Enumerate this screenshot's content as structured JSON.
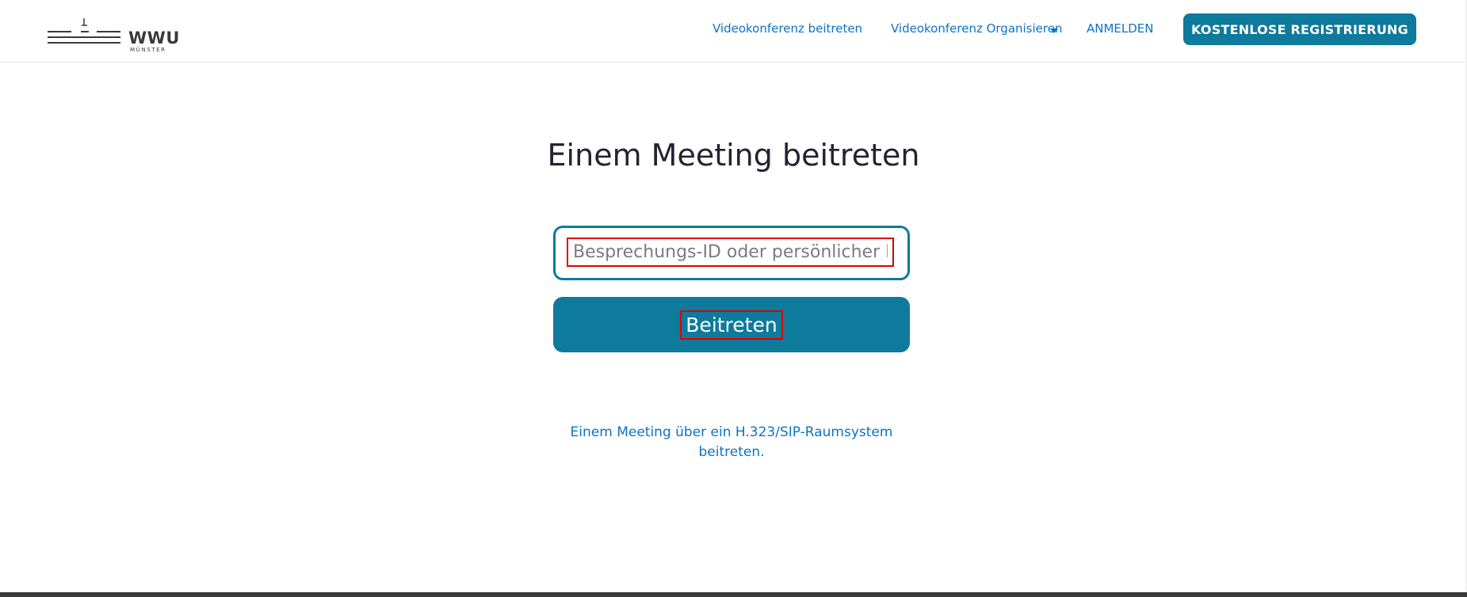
{
  "header": {
    "logo": {
      "name": "WWU",
      "sub": "MÜNSTER"
    },
    "nav": {
      "join_meeting": "Videokonferenz beitreten",
      "host_meeting": "Videokonferenz Organisieren",
      "sign_in": "ANMELDEN",
      "sign_up": "KOSTENLOSE REGISTRIERUNG"
    }
  },
  "main": {
    "title": "Einem Meeting beitreten",
    "meeting_input": {
      "placeholder": "Besprechungs-ID oder persönlicher Link-Name",
      "value": ""
    },
    "join_button": "Beitreten",
    "sip_link": "Einem Meeting über ein H.323/SIP-Raumsystem beitreten."
  },
  "colors": {
    "accent": "#0e7a9c",
    "link": "#0e72c4",
    "highlight": "#e00000",
    "title": "#232333"
  }
}
